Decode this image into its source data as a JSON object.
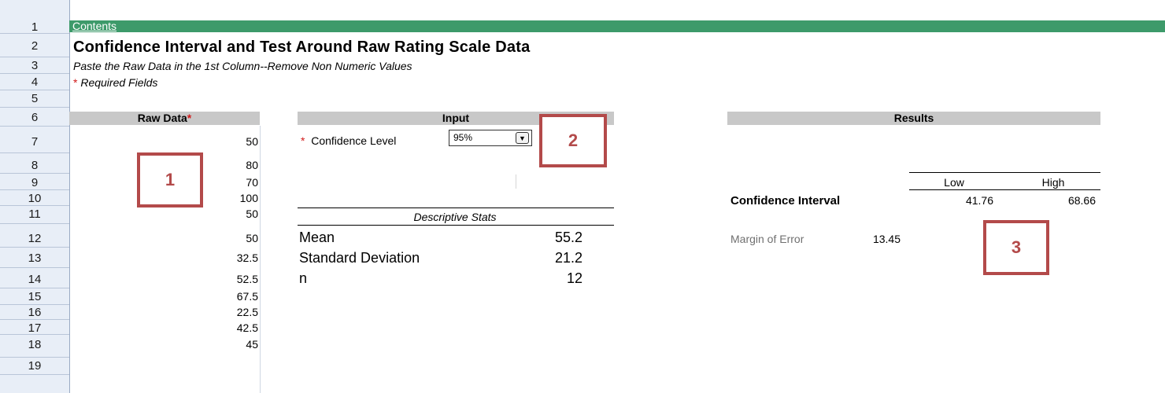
{
  "sheet": {
    "row_numbers": [
      "1",
      "2",
      "3",
      "4",
      "5",
      "6",
      "7",
      "8",
      "9",
      "10",
      "11",
      "12",
      "13",
      "14",
      "15",
      "16",
      "17",
      "18",
      "19"
    ],
    "contents_link": "Contents",
    "title": "Confidence Interval and Test Around Raw Rating Scale Data",
    "subtitle": "Paste the Raw Data in the 1st Column--Remove Non Numeric Values",
    "required_star": "*",
    "required_text": " Required Fields"
  },
  "raw_data": {
    "header": "Raw Data",
    "star": "*",
    "values": [
      "50",
      "80",
      "70",
      "100",
      "50",
      "50",
      "32.5",
      "52.5",
      "67.5",
      "22.5",
      "42.5",
      "45"
    ]
  },
  "input": {
    "header": "Input",
    "confidence_star": "*",
    "confidence_label": "Confidence Level",
    "confidence_value": "95%"
  },
  "descriptive": {
    "title": "Descriptive Stats",
    "mean_label": "Mean",
    "mean_value": "55.2",
    "sd_label": "Standard Deviation",
    "sd_value": "21.2",
    "n_label": "n",
    "n_value": "12"
  },
  "results": {
    "header": "Results",
    "low_label": "Low",
    "high_label": "High",
    "ci_label": "Confidence Interval",
    "ci_low": "41.76",
    "ci_high": "68.66",
    "moe_label": "Margin of Error",
    "moe_value": "13.45"
  },
  "callouts": {
    "c1": "1",
    "c2": "2",
    "c3": "3"
  },
  "colors": {
    "accent_green": "#3d9a6a",
    "callout_red": "#b34a4a",
    "required_red": "#d11a1a",
    "header_gray": "#c8c8c8"
  }
}
